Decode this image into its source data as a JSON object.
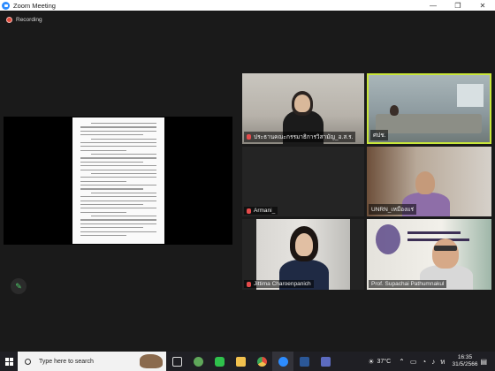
{
  "window": {
    "title": "Zoom Meeting",
    "controls": [
      "—",
      "❐",
      "✕"
    ]
  },
  "recording": {
    "label": "Recording"
  },
  "participants": [
    {
      "name": "ประธานคณะกรรมาธิการวิสามัญ_อ.ส.ร.",
      "muted": true
    },
    {
      "name": "ศปช.",
      "muted": false,
      "active_speaker": true
    },
    {
      "name": "Armani_",
      "muted": true
    },
    {
      "name": "UNRN_เหมืองแร่",
      "muted": false
    },
    {
      "name": "Jittima Charoenpanich",
      "muted": true
    },
    {
      "name": "Prof. Supachai Pathumnakul",
      "muted": false
    }
  ],
  "taskbar": {
    "search_placeholder": "Type here to search",
    "weather": "37°C",
    "time": "16:35",
    "date": "31/5/2566"
  },
  "colors": {
    "active_border": "#c9e63a",
    "recording_red": "#e24c3c",
    "zoom_blue": "#2d8cff"
  }
}
